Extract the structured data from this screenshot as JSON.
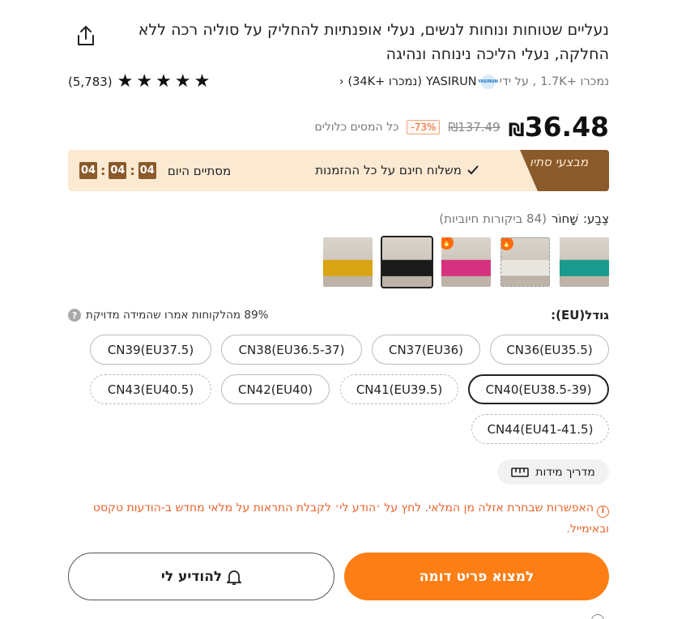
{
  "product": {
    "title": "נעליים שטוחות ונוחות לנשים, נעלי אופנתיות להחליק על סוליה רכה ללא החלקה, נעלי הליכה נינוחה ונהיגה",
    "sold": "נמכרו +1.7K",
    "by": ", על ידי",
    "store_logo_text": "YASIRUN",
    "store": "YASIRUN",
    "store_count": "(נמכרו +34K)",
    "rating_count": "(5,783)",
    "stars": 5
  },
  "price": {
    "current": "36.48",
    "currency": "₪",
    "old": "₪137.49",
    "discount": "-73%",
    "tax_note": "כל המסים כלולים"
  },
  "banner": {
    "badge": "מבצעי סתיו",
    "shipping": "משלוח חינם על כל ההזמנות",
    "ends_label": "מסתיים היום",
    "hours": "04",
    "minutes": "04",
    "seconds": "04"
  },
  "color": {
    "label": "צֶבַע:",
    "value": "שָׁחוֹר",
    "reviews": "(84 ביקורות חיוביות)",
    "thumbs": [
      {
        "name": "teal",
        "color": "#1a9a8c",
        "hot": false,
        "selected": false,
        "dashed": false
      },
      {
        "name": "white",
        "color": "#e9e6e0",
        "hot": true,
        "selected": false,
        "dashed": true
      },
      {
        "name": "pink",
        "color": "#d6317f",
        "hot": true,
        "selected": false,
        "dashed": false
      },
      {
        "name": "black",
        "color": "#1a1a1a",
        "hot": false,
        "selected": true,
        "dashed": false
      },
      {
        "name": "yellow",
        "color": "#d9a414",
        "hot": false,
        "selected": false,
        "dashed": false
      }
    ]
  },
  "size": {
    "label": "גודל(EU):",
    "fit_note": "89% מהלקוחות אמרו שהמידה מדויקת",
    "options": [
      {
        "label": "CN36(EU35.5)",
        "state": "normal"
      },
      {
        "label": "CN37(EU36)",
        "state": "normal"
      },
      {
        "label": "CN38(EU36.5-37)",
        "state": "normal"
      },
      {
        "label": "CN39(EU37.5)",
        "state": "normal"
      },
      {
        "label": "CN40(EU38.5-39)",
        "state": "selected"
      },
      {
        "label": "CN41(EU39.5)",
        "state": "dashed"
      },
      {
        "label": "CN42(EU40)",
        "state": "normal"
      },
      {
        "label": "CN43(EU40.5)",
        "state": "dashed"
      },
      {
        "label": "CN44(EU41-41.5)",
        "state": "dashed"
      }
    ],
    "guide": "מדריך מידות"
  },
  "warning": "האפשרות שבחרת אזלה מן המלאי. לחץ על ׳הודע לי׳ לקבלת התראות על מלאי מחדש ב-הודעות טקסט ובאימייל.",
  "actions": {
    "find_similar": "למצוא פריט דומה",
    "notify": "להודיע לי"
  }
}
